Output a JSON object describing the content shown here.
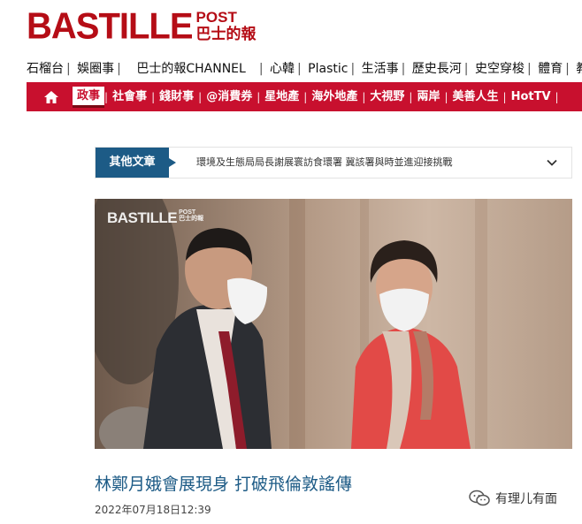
{
  "logo": {
    "main": "BASTILLE",
    "post": "POST",
    "cn": "巴士的報"
  },
  "top_nav": [
    "石榴台",
    "娛圈事",
    "巴士的報CHANNEL",
    "心韓",
    "Plastic",
    "生活事",
    "歷史長河",
    "史空穿梭",
    "體育",
    "教"
  ],
  "red_nav": {
    "home_icon": "home-icon",
    "items": [
      "政事",
      "社會事",
      "錢財事",
      "@消費券",
      "星地產",
      "海外地產",
      "大視野",
      "兩岸",
      "美善人生",
      "HotTV"
    ],
    "active_index": 0
  },
  "other_articles": {
    "tab_label": "其他文章",
    "text": "環境及生態局局長謝展寰訪食環署 冀該署與時並進迎接挑戰",
    "icon": "chevron-down-icon"
  },
  "photo": {
    "watermark_main": "BASTILLE",
    "watermark_post": "POST",
    "watermark_cn": "巴士的報"
  },
  "article": {
    "title": "林鄭月娥會展現身 打破飛倫敦謠傳",
    "date": "2022年07月18日12:39"
  },
  "brand": {
    "icon": "wechat-icon",
    "text": "有理儿有面"
  },
  "colors": {
    "brand_red": "#b50d16",
    "nav_red": "#c8102e",
    "accent_blue": "#1d5b86"
  }
}
